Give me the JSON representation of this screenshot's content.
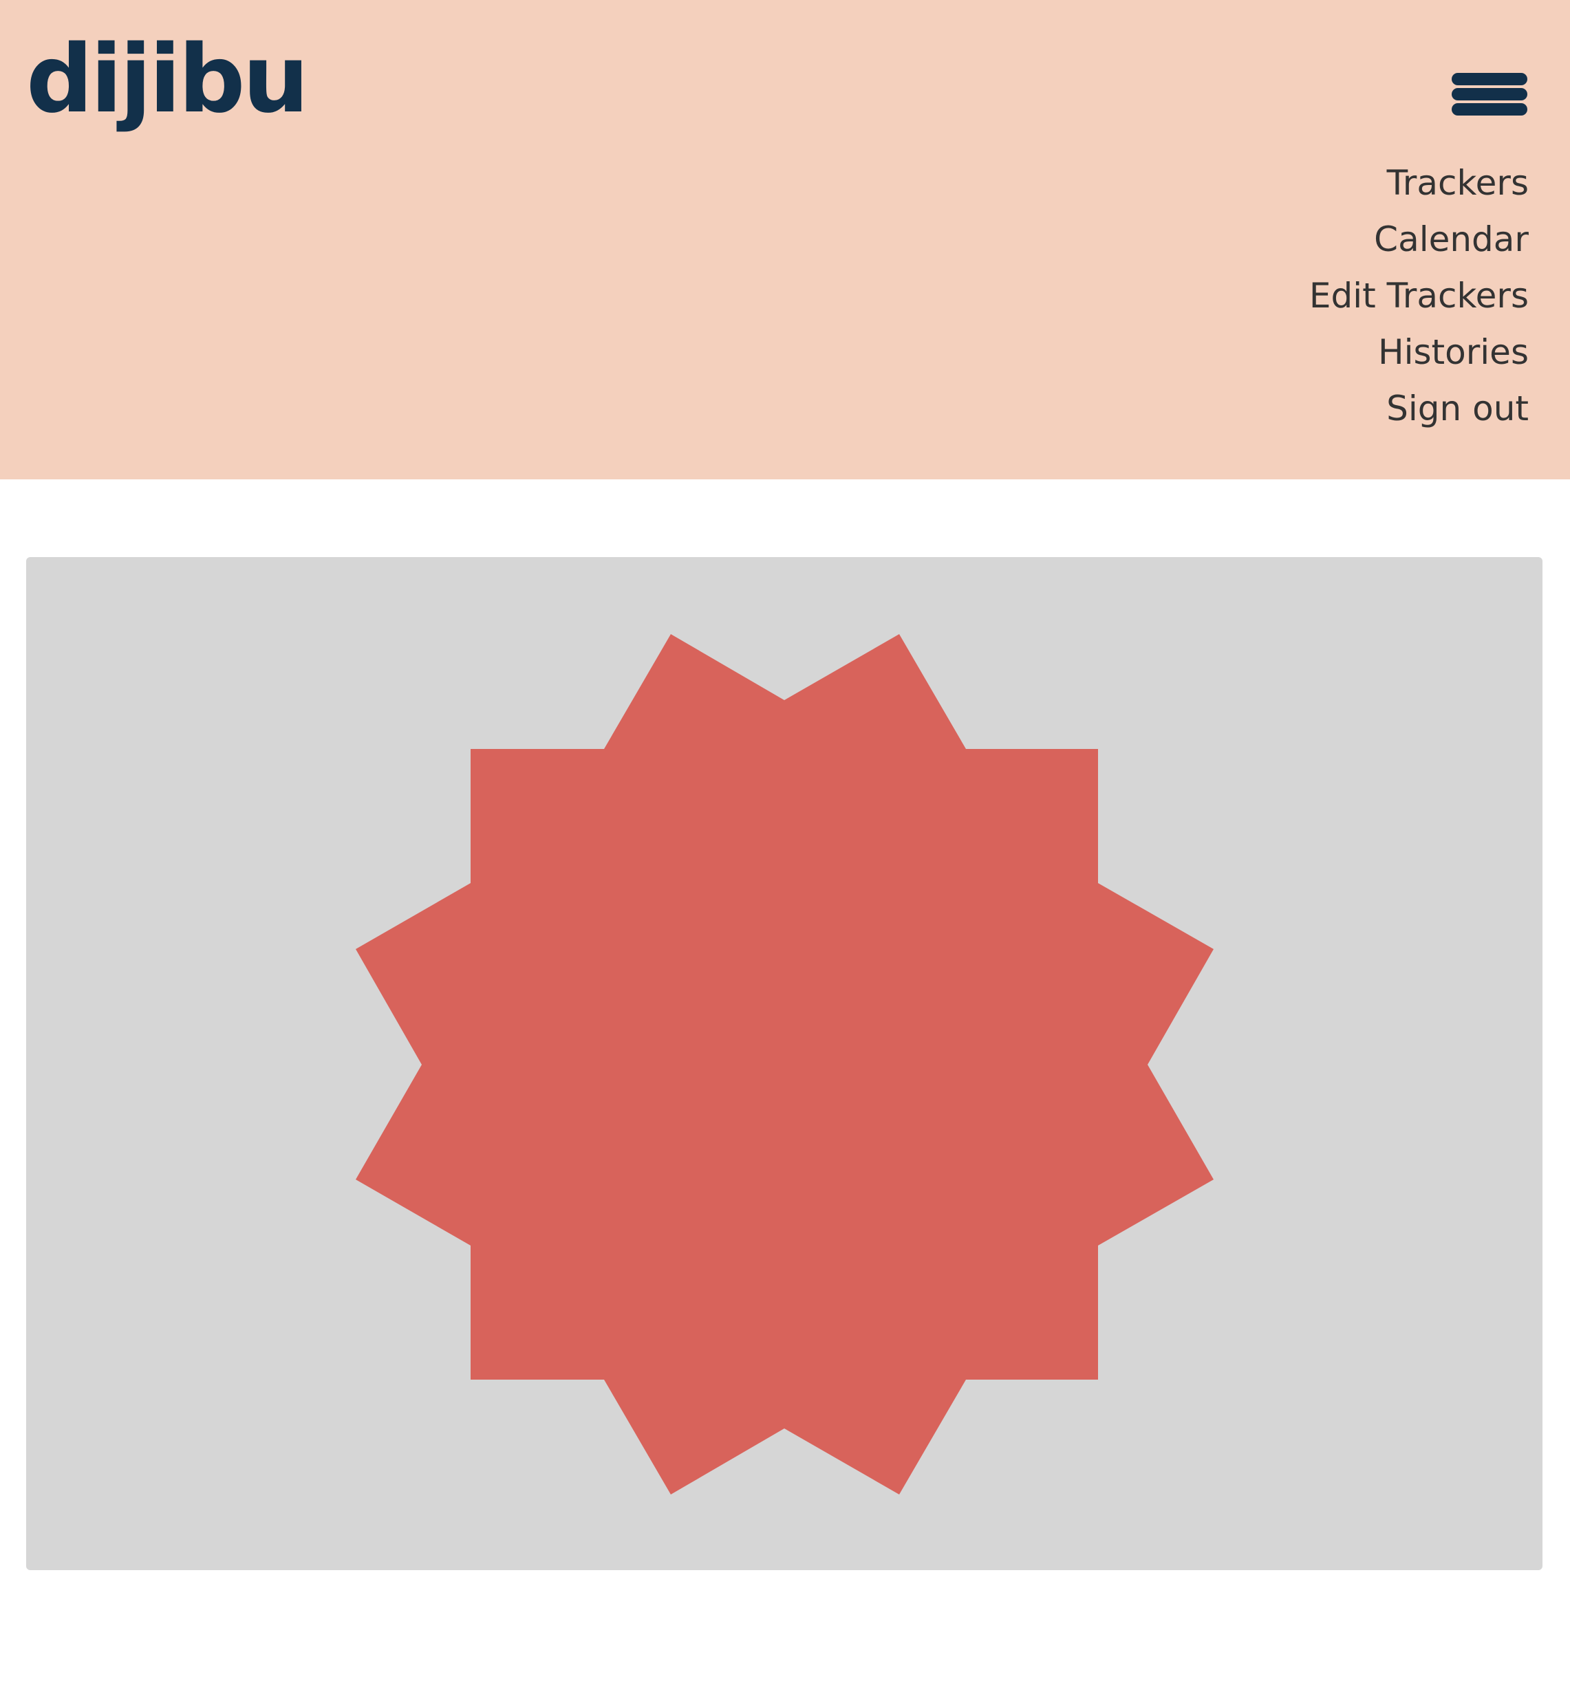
{
  "header": {
    "logo_text": "dijibu",
    "menu_icon": "hamburger-menu-icon",
    "nav_items": [
      {
        "label": "Trackers"
      },
      {
        "label": "Calendar"
      },
      {
        "label": "Edit Trackers"
      },
      {
        "label": "Histories"
      },
      {
        "label": "Sign out"
      }
    ]
  },
  "main": {
    "graphic": "star-badge-icon"
  },
  "colors": {
    "header_bg": "#F4D0BD",
    "brand": "#12304A",
    "nav_text": "#333333",
    "card_bg": "#D6D6D6",
    "star_fill": "#D8635B",
    "page_bg": "#FFFFFF"
  }
}
